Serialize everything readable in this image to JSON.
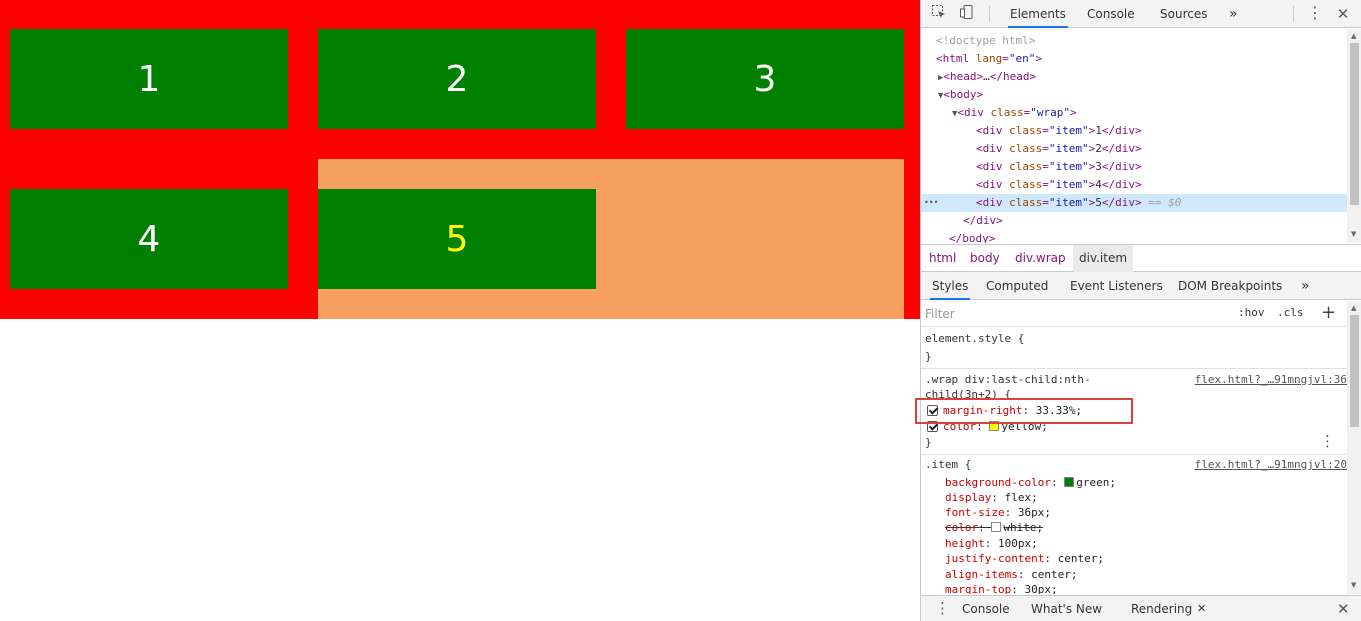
{
  "page": {
    "items": [
      "1",
      "2",
      "3",
      "4",
      "5"
    ],
    "colors": {
      "wrap": "#ff0000",
      "item": "#008000",
      "item_text": "#ffffff",
      "last_item_text": "#ffff00",
      "margin_highlight": "#f6a060"
    }
  },
  "devtools": {
    "tabs": [
      "Elements",
      "Console",
      "Sources"
    ],
    "more_tabs": "»",
    "dom": {
      "doctype": "<!doctype html>",
      "html_tag": "html",
      "html_attr": "lang",
      "html_attr_val": "\"en\"",
      "head_tag": "head",
      "head_collapsed": "…",
      "body_tag": "body",
      "wrap_tag": "div",
      "wrap_attr": "class",
      "wrap_attr_val": "\"wrap\"",
      "items": [
        {
          "tag": "div",
          "attr": "class",
          "val": "\"item\"",
          "text": "1"
        },
        {
          "tag": "div",
          "attr": "class",
          "val": "\"item\"",
          "text": "2"
        },
        {
          "tag": "div",
          "attr": "class",
          "val": "\"item\"",
          "text": "3"
        },
        {
          "tag": "div",
          "attr": "class",
          "val": "\"item\"",
          "text": "4"
        },
        {
          "tag": "div",
          "attr": "class",
          "val": "\"item\"",
          "text": "5"
        }
      ],
      "selected_marker": "== $0",
      "ellipsis": "•••"
    },
    "breadcrumbs": [
      "html",
      "body",
      "div.wrap",
      "div.item"
    ],
    "styles_tabs": [
      "Styles",
      "Computed",
      "Event Listeners",
      "DOM Breakpoints"
    ],
    "filter_placeholder": "Filter",
    "hov": ":hov",
    "cls": ".cls",
    "plus": "+",
    "rules": {
      "element_style": "element.style {",
      "close_brace": "}",
      "rule1_selector_a": ".wrap div:last-child:nth-",
      "rule1_selector_b": "child(3n+2) {",
      "rule1_source": "flex.html?_…91mngjvl:36",
      "rule1_props": [
        {
          "name": "margin-right",
          "value": "33.33%;"
        },
        {
          "name": "color",
          "value": "yellow;",
          "swatch": "#ffff00"
        }
      ],
      "rule2_selector": ".item {",
      "rule2_source": "flex.html?_…91mngjvl:20",
      "rule2_props": [
        {
          "name": "background-color",
          "value": "green;",
          "swatch": "#008000"
        },
        {
          "name": "display",
          "value": "flex;"
        },
        {
          "name": "font-size",
          "value": "36px;"
        },
        {
          "name": "color",
          "value": "white;",
          "swatch": "#ffffff",
          "overridden": true
        },
        {
          "name": "height",
          "value": "100px;"
        },
        {
          "name": "justify-content",
          "value": "center;"
        },
        {
          "name": "align-items",
          "value": "center;"
        },
        {
          "name": "margin-top",
          "value": "30px;"
        }
      ]
    },
    "drawer_tabs": [
      "Console",
      "What's New",
      "Rendering"
    ],
    "highlight_color": "#d9413a"
  }
}
